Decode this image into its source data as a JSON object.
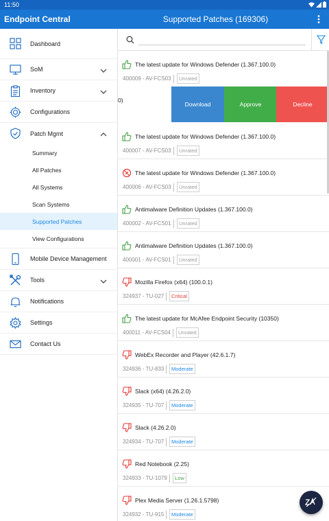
{
  "status_bar": {
    "time": "11:50"
  },
  "app_bar": {
    "brand": "Endpoint Central",
    "title": "Supported Patches (169306)"
  },
  "sidebar": {
    "items": [
      {
        "label": "Dashboard"
      },
      {
        "label": "SoM"
      },
      {
        "label": "Inventory"
      },
      {
        "label": "Configurations"
      },
      {
        "label": "Patch Mgmt"
      },
      {
        "label": "Mobile Device Management"
      },
      {
        "label": "Tools"
      },
      {
        "label": "Notifications"
      },
      {
        "label": "Settings"
      },
      {
        "label": "Contact Us"
      }
    ],
    "patch_sub_items": [
      {
        "label": "Summary"
      },
      {
        "label": "All Patches"
      },
      {
        "label": "All Systems"
      },
      {
        "label": "Scan Systems"
      },
      {
        "label": "Supported Patches",
        "active": true
      },
      {
        "label": "View Configurations"
      }
    ]
  },
  "search": {
    "placeholder": "",
    "value": ""
  },
  "swipe_actions": {
    "peek_text": "0)",
    "download": "Download",
    "approve": "Approve",
    "decline": "Decline"
  },
  "patches": [
    {
      "title": "The latest update for Windows Defender (1.367.100.0)",
      "id": "400009 - AV-FCS03",
      "severity": "Unrated",
      "icon": "thumbs-up-icon"
    },
    {
      "title": "The latest update for Windows Defender (1.367.100.0)",
      "id": "400007 - AV-FCS03",
      "severity": "Unrated",
      "icon": "thumbs-up-icon"
    },
    {
      "title": "The latest update for Windows Defender (1.367.100.0)",
      "id": "400006 - AV-FCS03",
      "severity": "Unrated",
      "icon": "blocked-icon"
    },
    {
      "title": "Antimalware Definition Updates (1.367.100.0)",
      "id": "400002 - AV-FCS01",
      "severity": "Unrated",
      "icon": "thumbs-up-icon"
    },
    {
      "title": "Antimalware Definition Updates (1.367.100.0)",
      "id": "400001 - AV-FCS01",
      "severity": "Unrated",
      "icon": "thumbs-up-icon"
    },
    {
      "title": "Mozilla Firefox (x64) (100.0.1)",
      "id": "324937 - TU-027",
      "severity": "Critical",
      "icon": "thumbs-down-icon"
    },
    {
      "title": "The latest update for McAfee Endpoint Security (10350)",
      "id": "400011 - AV-FCS04",
      "severity": "Unrated",
      "icon": "thumbs-up-icon"
    },
    {
      "title": "WebEx Recorder and Player (42.6.1.7)",
      "id": "324936 - TU-833",
      "severity": "Moderate",
      "icon": "thumbs-down-icon"
    },
    {
      "title": "Slack (x64) (4.26.2.0)",
      "id": "324935 - TU-707",
      "severity": "Moderate",
      "icon": "thumbs-down-icon"
    },
    {
      "title": "Slack (4.26.2.0)",
      "id": "324934 - TU-707",
      "severity": "Moderate",
      "icon": "thumbs-down-icon"
    },
    {
      "title": "Red Notebook (2.25)",
      "id": "324933 - TU-1079",
      "severity": "Low",
      "icon": "thumbs-down-icon"
    },
    {
      "title": "Plex Media Server (1.26.1.5798)",
      "id": "324932 - TU-915",
      "severity": "Moderate",
      "icon": "thumbs-down-icon"
    }
  ],
  "colors": {
    "app_bar": "#1976d2",
    "status_bar": "#1565c0",
    "approved_icon": "#43a047",
    "declined_icon": "#e53935",
    "severity_unrated": "#9e9e9e",
    "severity_critical": "#e53935",
    "severity_moderate": "#1e88e5",
    "severity_low": "#43a047"
  }
}
